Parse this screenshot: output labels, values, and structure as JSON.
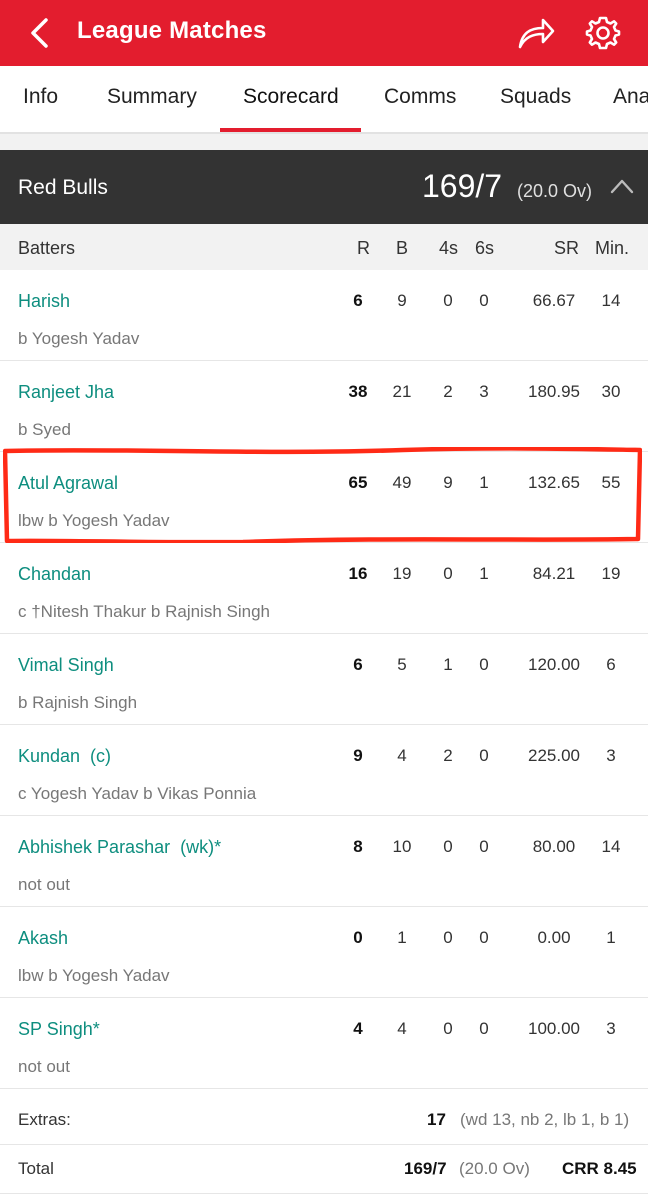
{
  "header": {
    "title": "League Matches",
    "colors": {
      "brand": "#e31d2e",
      "team_bar": "#333333",
      "player_link": "#0e8e7f",
      "annotation": "#ff2a16"
    }
  },
  "tabs": [
    {
      "label": "Info"
    },
    {
      "label": "Summary"
    },
    {
      "label": "Scorecard",
      "active": true
    },
    {
      "label": "Comms"
    },
    {
      "label": "Squads"
    },
    {
      "label": "Ana"
    }
  ],
  "innings": {
    "team": "Red Bulls",
    "score": "169/7",
    "overs": "(20.0 Ov)"
  },
  "columns": {
    "batters": "Batters",
    "r": "R",
    "b": "B",
    "fours": "4s",
    "sixes": "6s",
    "sr": "SR",
    "min": "Min."
  },
  "batters": [
    {
      "name": "Harish",
      "dismissal": "b Yogesh Yadav",
      "r": "6",
      "b": "9",
      "fours": "0",
      "sixes": "0",
      "sr": "66.67",
      "min": "14"
    },
    {
      "name": "Ranjeet Jha",
      "dismissal": "b Syed",
      "r": "38",
      "b": "21",
      "fours": "2",
      "sixes": "3",
      "sr": "180.95",
      "min": "30"
    },
    {
      "name": "Atul Agrawal",
      "dismissal": "lbw b Yogesh Yadav",
      "r": "65",
      "b": "49",
      "fours": "9",
      "sixes": "1",
      "sr": "132.65",
      "min": "55"
    },
    {
      "name": "Chandan",
      "dismissal": "c †Nitesh Thakur b Rajnish Singh",
      "r": "16",
      "b": "19",
      "fours": "0",
      "sixes": "1",
      "sr": "84.21",
      "min": "19"
    },
    {
      "name": "Vimal Singh",
      "dismissal": "b Rajnish Singh",
      "r": "6",
      "b": "5",
      "fours": "1",
      "sixes": "0",
      "sr": "120.00",
      "min": "6"
    },
    {
      "name": "Kundan  (c)",
      "dismissal": "c Yogesh Yadav b Vikas Ponnia",
      "r": "9",
      "b": "4",
      "fours": "2",
      "sixes": "0",
      "sr": "225.00",
      "min": "3"
    },
    {
      "name": "Abhishek Parashar  (wk)*",
      "dismissal": "not out",
      "r": "8",
      "b": "10",
      "fours": "0",
      "sixes": "0",
      "sr": "80.00",
      "min": "14"
    },
    {
      "name": "Akash",
      "dismissal": "lbw b Yogesh Yadav",
      "r": "0",
      "b": "1",
      "fours": "0",
      "sixes": "0",
      "sr": "0.00",
      "min": "1"
    },
    {
      "name": "SP Singh*",
      "dismissal": "not out",
      "r": "4",
      "b": "4",
      "fours": "0",
      "sixes": "0",
      "sr": "100.00",
      "min": "3"
    }
  ],
  "extras": {
    "label": "Extras:",
    "value": "17",
    "detail": "(wd 13, nb 2, lb 1, b 1)"
  },
  "total": {
    "label": "Total",
    "score": "169/7",
    "overs": "(20.0 Ov)",
    "crr": "CRR 8.45"
  },
  "icons": {
    "back": "chevron-left-icon",
    "share": "share-icon",
    "settings": "gear-icon",
    "collapse": "chevron-up-icon"
  }
}
